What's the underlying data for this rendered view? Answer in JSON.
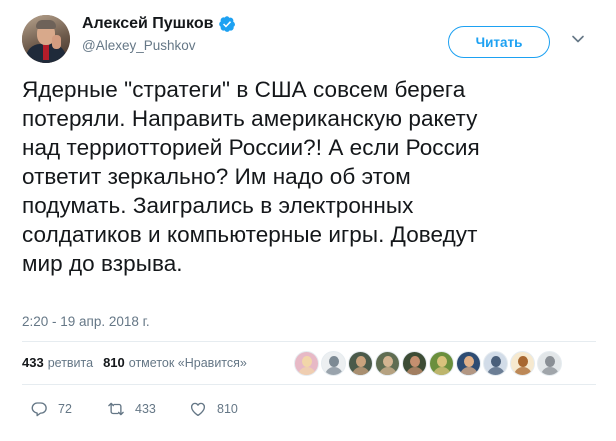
{
  "author": {
    "display_name": "Алексей Пушков",
    "username": "@Alexey_Pushkov",
    "verified": true
  },
  "follow_button_label": "Читать",
  "tweet": {
    "text": "Ядерные \"стратеги\" в США совсем берега\nпотеряли. Направить американскую ракету\nнад терриотторией России?! А если Россия\nответит зеркально? Им надо об этом\nподумать. Заигрались в электронных\nсолдатиков и компьютерные игры. Доведут\nмир до взрыва.",
    "timestamp": "2:20 - 19 апр. 2018 г."
  },
  "stats": {
    "retweets_count": "433",
    "retweets_label": "ретвита",
    "likes_count": "810",
    "likes_label": "отметок «Нравится»"
  },
  "liker_avatars": [
    {
      "name": "liker-avatar-1",
      "color": "#e7b9c6",
      "accent": "#f2d6a9"
    },
    {
      "name": "liker-avatar-2",
      "color": "#eceff1",
      "accent": "#7d8a94"
    },
    {
      "name": "liker-avatar-3",
      "color": "#4a5a4a",
      "accent": "#c9a27d"
    },
    {
      "name": "liker-avatar-4",
      "color": "#5f6d52",
      "accent": "#d3b491"
    },
    {
      "name": "liker-avatar-5",
      "color": "#3c4c35",
      "accent": "#c48f6f"
    },
    {
      "name": "liker-avatar-6",
      "color": "#6a8f3d",
      "accent": "#d9c27c"
    },
    {
      "name": "liker-avatar-7",
      "color": "#2d4c73",
      "accent": "#e0b088"
    },
    {
      "name": "liker-avatar-8",
      "color": "#d2dce8",
      "accent": "#4a5f7a"
    },
    {
      "name": "liker-avatar-9",
      "color": "#f6e9cf",
      "accent": "#a8672f"
    },
    {
      "name": "liker-avatar-10",
      "color": "#e2e6e8",
      "accent": "#8a8f95"
    }
  ],
  "actions": {
    "replies_count": "72",
    "retweets_count": "433",
    "likes_count": "810"
  },
  "colors": {
    "accent": "#1da1f2",
    "text": "#14171a",
    "muted": "#657786",
    "divider": "#e6ecf0"
  },
  "icons": [
    "verified-badge-icon",
    "chevron-down-icon",
    "reply-icon",
    "retweet-icon",
    "like-heart-icon"
  ]
}
